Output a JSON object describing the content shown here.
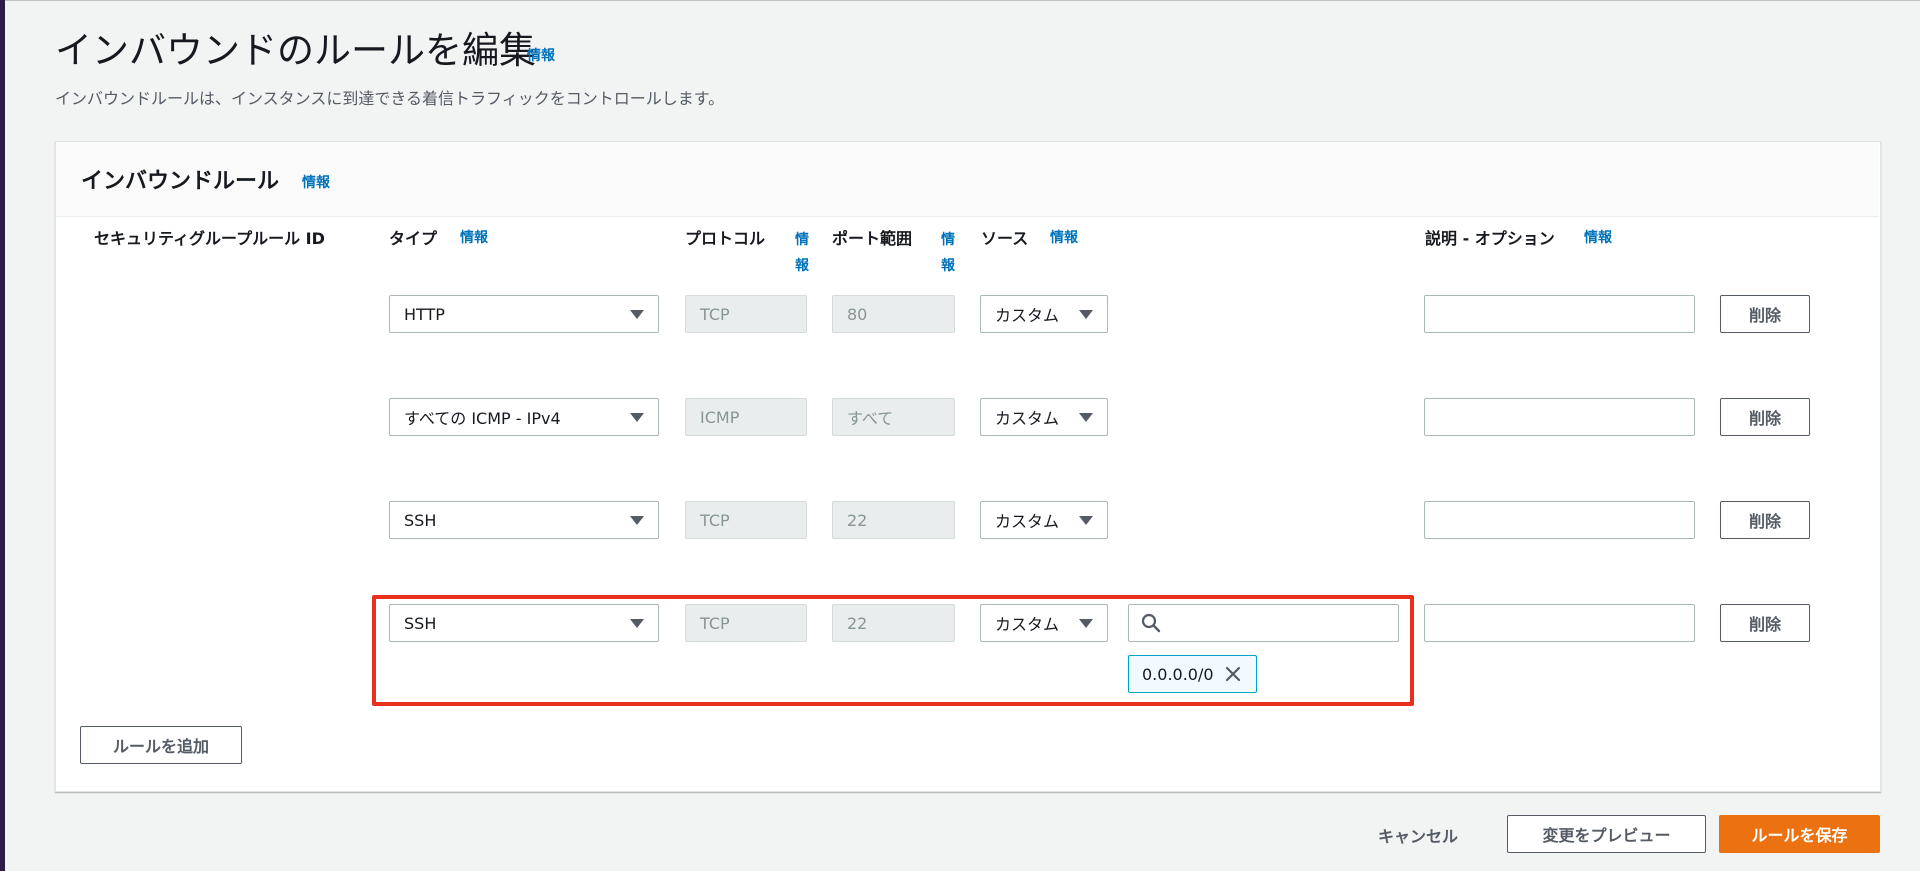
{
  "page": {
    "title": "インバウンドのルールを編集",
    "title_info": "情報",
    "description": "インバウンドルールは、インスタンスに到達できる着信トラフィックをコントロールします。"
  },
  "panel": {
    "title": "インバウンドルール",
    "title_info": "情報",
    "columns": {
      "rule_id": "セキュリティグループルール ID",
      "type": "タイプ",
      "type_info": "情報",
      "protocol": "プロトコル",
      "protocol_info": "情報",
      "port_range": "ポート範囲",
      "port_range_info": "情報",
      "source": "ソース",
      "source_info": "情報",
      "description": "説明 - オプション",
      "description_info": "情報"
    },
    "rules": [
      {
        "type": "HTTP",
        "protocol": "TCP",
        "port_range": "80",
        "source": "カスタム",
        "delete_label": "削除"
      },
      {
        "type": "すべての ICMP - IPv4",
        "protocol": "ICMP",
        "port_range": "すべて",
        "source": "カスタム",
        "delete_label": "削除"
      },
      {
        "type": "SSH",
        "protocol": "TCP",
        "port_range": "22",
        "source": "カスタム",
        "delete_label": "削除"
      },
      {
        "type": "SSH",
        "protocol": "TCP",
        "port_range": "22",
        "source": "カスタム",
        "source_token": "0.0.0.0/0",
        "delete_label": "削除"
      }
    ],
    "add_rule_label": "ルールを追加"
  },
  "footer": {
    "cancel_label": "キャンセル",
    "preview_label": "変更をプレビュー",
    "save_label": "ルールを保存"
  },
  "colors": {
    "accent": "#ec7211",
    "link": "#0073bb",
    "highlight": "#e8301d"
  }
}
